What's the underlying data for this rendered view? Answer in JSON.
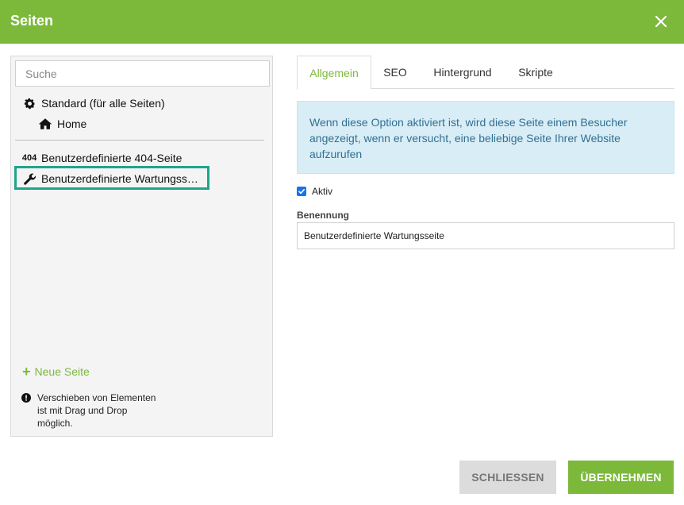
{
  "dialog": {
    "title": "Seiten",
    "close_icon": "close-icon"
  },
  "search": {
    "placeholder": "Suche",
    "value": ""
  },
  "tree": {
    "items": [
      {
        "label": "Standard (für alle Seiten)",
        "icon": "gear-icon"
      },
      {
        "label": "Home",
        "icon": "home-icon"
      },
      {
        "label": "Benutzerdefinierte 404-Seite",
        "icon_text": "404"
      },
      {
        "label": "Benutzerdefinierte Wartungss…",
        "icon": "wrench-icon",
        "selected": true
      }
    ]
  },
  "sidebar_footer": {
    "new_page": "Neue Seite",
    "info_line1": "Verschieben von Elementen",
    "info_line2": "ist mit Drag und Drop",
    "info_line3": "möglich."
  },
  "tabs": [
    {
      "label": "Allgemein",
      "active": true
    },
    {
      "label": "SEO"
    },
    {
      "label": "Hintergrund"
    },
    {
      "label": "Skripte"
    }
  ],
  "alert": {
    "text": "Wenn diese Option aktiviert ist, wird diese Seite einem Besucher angezeigt, wenn er versucht, eine beliebige Seite Ihrer Website aufzurufen"
  },
  "form": {
    "aktiv_label": "Aktiv",
    "aktiv_checked": true,
    "benennung_label": "Benennung",
    "benennung_value": "Benutzerdefinierte Wartungsseite"
  },
  "buttons": {
    "close": "SCHLIESSEN",
    "apply": "ÜBERNEHMEN"
  },
  "colors": {
    "accent": "#7cb93b",
    "selection": "#1ea58a",
    "info_bg": "#d9edf7",
    "info_text": "#31708f",
    "checkbox": "#1a73e8"
  }
}
